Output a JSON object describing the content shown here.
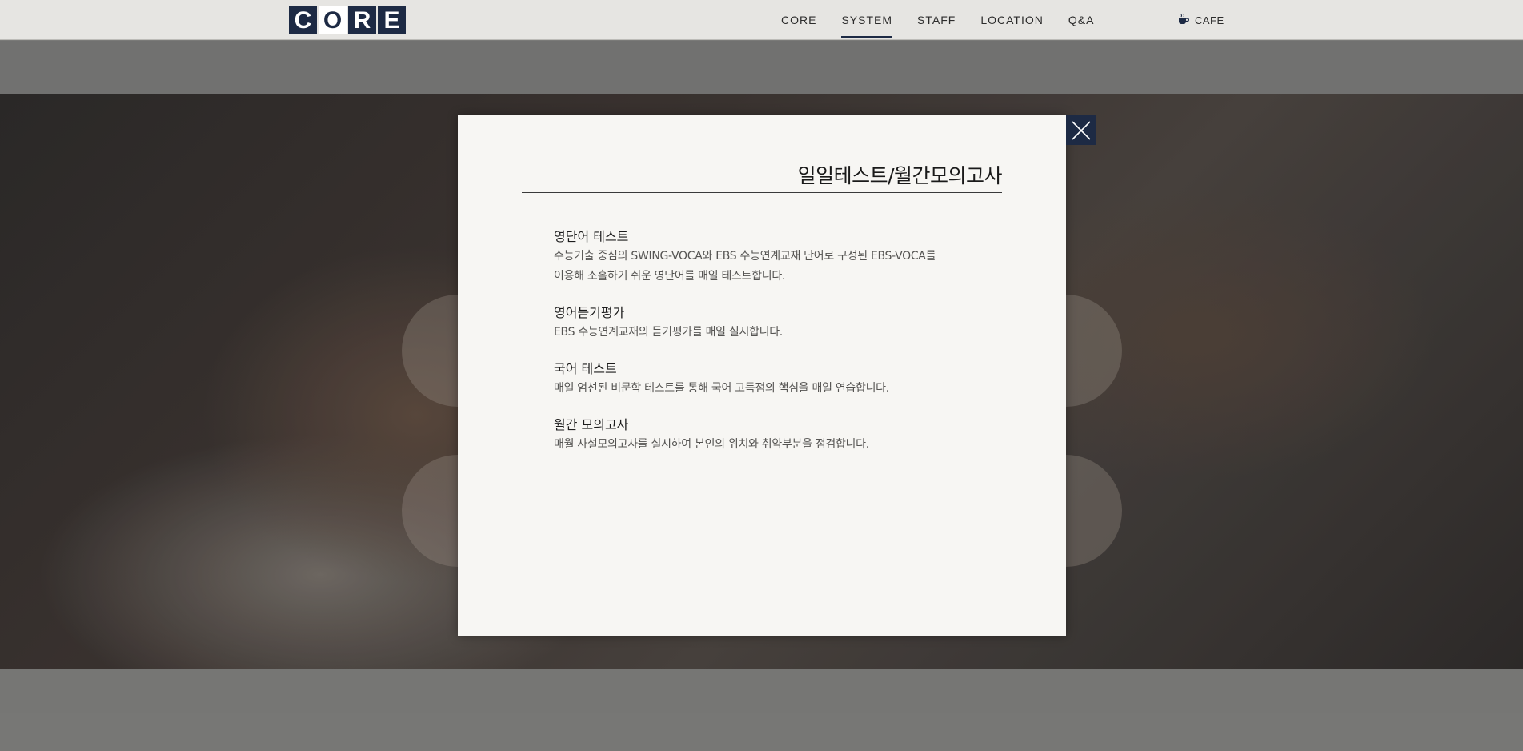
{
  "header": {
    "logo_letters": [
      "C",
      "O",
      "R",
      "E"
    ],
    "nav": [
      {
        "label": "CORE",
        "active": false
      },
      {
        "label": "SYSTEM",
        "active": true
      },
      {
        "label": "STAFF",
        "active": false
      },
      {
        "label": "LOCATION",
        "active": false
      },
      {
        "label": "Q&A",
        "active": false
      }
    ],
    "cafe_label": "CAFE",
    "cafe_icon": "coffee-cup-icon"
  },
  "modal": {
    "title": "일일테스트/월간모의고사",
    "close_icon": "close-icon",
    "sections": [
      {
        "title": "영단어 테스트",
        "lines": [
          "수능기출 중심의 SWING-VOCA와 EBS 수능연계교재 단어로 구성된 EBS-VOCA를",
          "이용해 소홀하기 쉬운 영단어를 매일 테스트합니다."
        ]
      },
      {
        "title": "영어듣기평가",
        "lines": [
          "EBS 수능연계교재의 듣기평가를 매일 실시합니다."
        ]
      },
      {
        "title": "국어 테스트",
        "lines": [
          "매일 엄선된 비문학 테스트를 통해 국어 고득점의 핵심을 매일 연습합니다."
        ]
      },
      {
        "title": "월간 모의고사",
        "lines": [
          "매월 사설모의고사를 실시하여 본인의 위치와 취약부분을 점검합니다."
        ]
      }
    ]
  },
  "colors": {
    "brand_navy": "#1d2a44",
    "modal_bg": "#f7f6f3",
    "header_bg": "#e6e5e2"
  }
}
